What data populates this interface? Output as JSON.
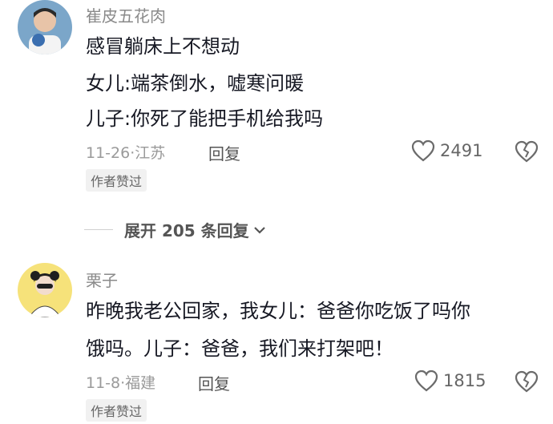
{
  "comments": [
    {
      "username": "崔皮五花肉",
      "lines": [
        "感冒躺床上不想动",
        "女儿:端茶倒水，嘘寒问暖",
        "儿子:你死了能把手机给我吗"
      ],
      "date": "11-26",
      "location": "江苏",
      "reply_label": "回复",
      "likes": "2491",
      "badge": "作者赞过"
    },
    {
      "username": "栗子",
      "lines": [
        "昨晚我老公回家，我女儿：爸爸你吃饭了吗你",
        "饿吗。儿子：爸爸，我们来打架吧！"
      ],
      "date": "11-8",
      "location": "福建",
      "reply_label": "回复",
      "likes": "1815",
      "badge": "作者赞过"
    }
  ],
  "expand_replies": {
    "label": "展开 205 条回复"
  },
  "icons": {
    "like": "heart-outline-icon",
    "dislike": "broken-heart-icon",
    "expand": "chevron-down-icon"
  }
}
